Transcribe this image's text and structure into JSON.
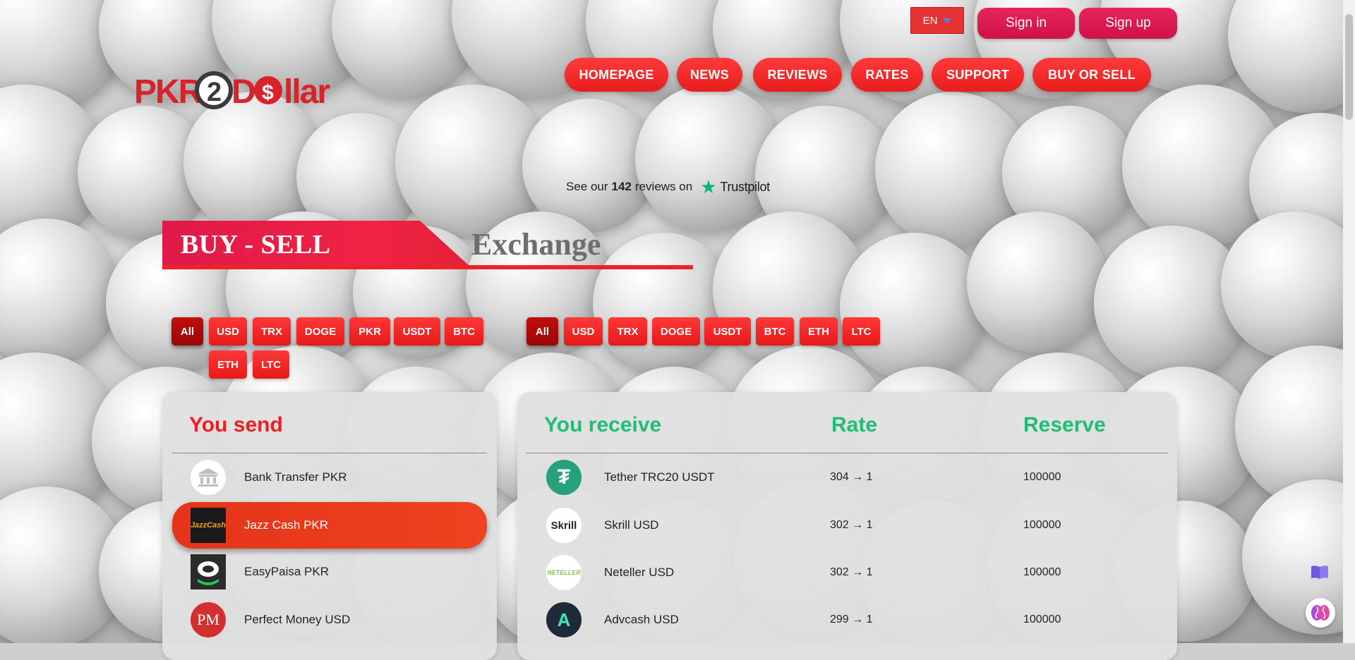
{
  "header": {
    "logo_text": "PKR2DOllar",
    "language": "EN",
    "sign_in": "Sign in",
    "sign_up": "Sign up",
    "nav": [
      "HOMEPAGE",
      "NEWS",
      "REVIEWS",
      "RATES",
      "SUPPORT",
      "BUY OR SELL"
    ]
  },
  "trustpilot": {
    "prefix": "See our",
    "count": "142",
    "suffix": "reviews on",
    "brand": "Trustpilot"
  },
  "title": {
    "main": "BUY - SELL",
    "secondary": "Exchange"
  },
  "send_filters": [
    "All",
    "USD",
    "TRX",
    "DOGE",
    "PKR",
    "USDT",
    "BTC",
    "ETH",
    "LTC"
  ],
  "receive_filters": [
    "All",
    "USD",
    "TRX",
    "DOGE",
    "USDT",
    "BTC",
    "ETH",
    "LTC"
  ],
  "send_panel": {
    "heading": "You send",
    "items": [
      {
        "label": "Bank Transfer PKR",
        "icon": "bank-icon"
      },
      {
        "label": "Jazz Cash PKR",
        "icon": "jazzcash-icon",
        "icon_text": "JazzCash"
      },
      {
        "label": "EasyPaisa PKR",
        "icon": "easypaisa-icon"
      },
      {
        "label": "Perfect Money USD",
        "icon": "perfect-money-icon",
        "icon_text": "PM"
      }
    ]
  },
  "receive_panel": {
    "heading": "You receive",
    "rate_heading": "Rate",
    "reserve_heading": "Reserve",
    "items": [
      {
        "label": "Tether TRC20 USDT",
        "rate": "304 → 1",
        "reserve": "100000",
        "icon": "tether-icon",
        "icon_text": "₮"
      },
      {
        "label": "Skrill USD",
        "rate": "302 → 1",
        "reserve": "100000",
        "icon": "skrill-icon",
        "icon_text": "Skrill"
      },
      {
        "label": "Neteller USD",
        "rate": "302 → 1",
        "reserve": "100000",
        "icon": "neteller-icon",
        "icon_text": "NETELLER"
      },
      {
        "label": "Advcash USD",
        "rate": "299 → 1",
        "reserve": "100000",
        "icon": "advcash-icon",
        "icon_text": "A"
      }
    ]
  },
  "colors": {
    "accent_red": "#ee1d24",
    "accent_pink": "#e0194a",
    "accent_green": "#1fbf73",
    "trustpilot_green": "#00b67a"
  }
}
